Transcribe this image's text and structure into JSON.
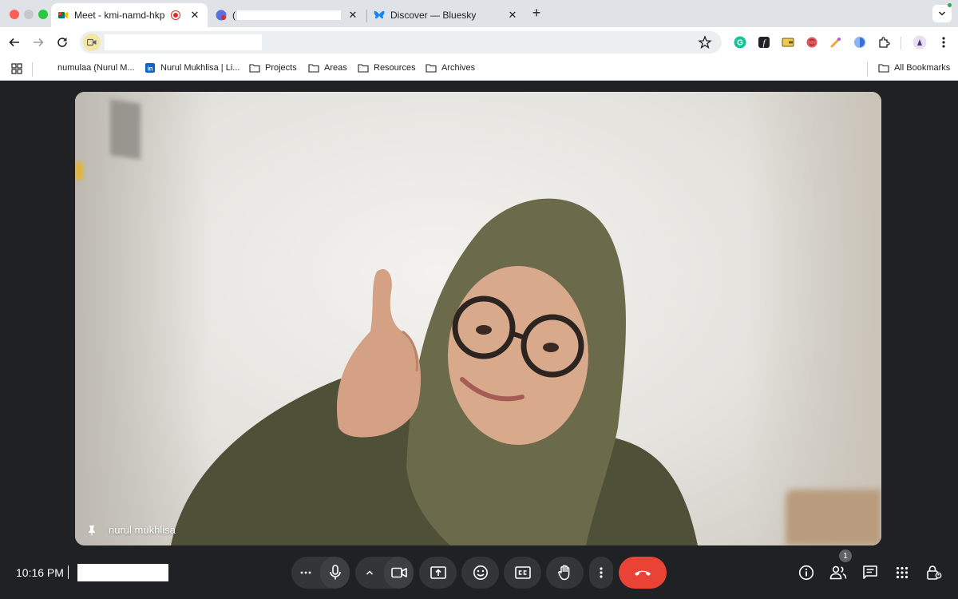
{
  "browser": {
    "tabs": [
      {
        "title": "Meet - kmi-namd-hkp",
        "active": true,
        "recording": true
      },
      {
        "title": "(",
        "active": false
      },
      {
        "title": "Discover — Bluesky",
        "active": false
      }
    ],
    "new_tab_label": "+",
    "close_label": "✕",
    "address_bar": {
      "url": ""
    },
    "bookmarks": [
      {
        "label": "numulaa (Nurul M...",
        "icon": "github-icon"
      },
      {
        "label": "Nurul Mukhlisa | Li...",
        "icon": "linkedin-icon"
      },
      {
        "label": "Projects",
        "icon": "folder-icon"
      },
      {
        "label": "Areas",
        "icon": "folder-icon"
      },
      {
        "label": "Resources",
        "icon": "folder-icon"
      },
      {
        "label": "Archives",
        "icon": "folder-icon"
      }
    ],
    "all_bookmarks_label": "All Bookmarks"
  },
  "meet": {
    "participant_name": "nurul mukhlisa",
    "clock": "10:16 PM",
    "meeting_code": "",
    "people_count": "1",
    "end_call_color": "#ea4335",
    "accent": "#8ab4f8"
  }
}
